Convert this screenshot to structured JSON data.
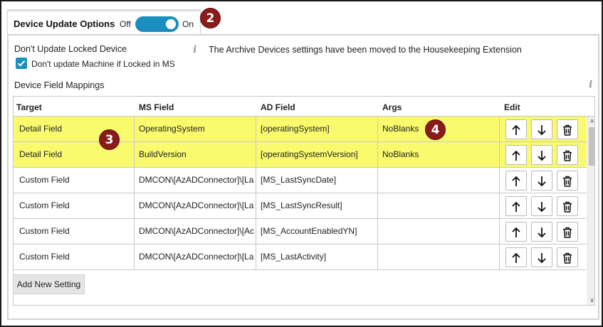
{
  "header": {
    "title": "Device Update Options",
    "toggle_off_label": "Off",
    "toggle_on_label": "On",
    "toggle_state": "on"
  },
  "annotations": {
    "badge_2": "2",
    "badge_3": "3",
    "badge_4": "4"
  },
  "locked": {
    "label": "Don't Update Locked Device",
    "checkbox_label": "Don't update Machine if Locked in MS",
    "checked": true
  },
  "archive_message": "The Archive Devices settings have been moved to the Housekeeping Extension",
  "mappings": {
    "label": "Device Field Mappings",
    "columns": [
      "Target",
      "MS Field",
      "AD Field",
      "Args",
      "Edit"
    ],
    "rows": [
      {
        "target": "Detail Field",
        "ms_field": "OperatingSystem",
        "ad_field": "[operatingSystem]",
        "args": "NoBlanks",
        "highlighted": true
      },
      {
        "target": "Detail Field",
        "ms_field": "BuildVersion",
        "ad_field": "[operatingSystemVersion]",
        "args": "NoBlanks",
        "highlighted": true
      },
      {
        "target": "Custom Field",
        "ms_field": "DMCON\\[AzADConnector]\\[La",
        "ad_field": "[MS_LastSyncDate]",
        "args": "",
        "highlighted": false
      },
      {
        "target": "Custom Field",
        "ms_field": "DMCON\\[AzADConnector]\\[La",
        "ad_field": "[MS_LastSyncResult]",
        "args": "",
        "highlighted": false
      },
      {
        "target": "Custom Field",
        "ms_field": "DMCON\\[AzADConnector]\\[Ac",
        "ad_field": "[MS_AccountEnabledYN]",
        "args": "",
        "highlighted": false
      },
      {
        "target": "Custom Field",
        "ms_field": "DMCON\\[AzADConnector]\\[La",
        "ad_field": "[MS_LastActivity]",
        "args": "",
        "highlighted": false
      }
    ]
  },
  "add_button_label": "Add New Setting",
  "colors": {
    "accent": "#1a8fbf",
    "highlight": "#fafa6e",
    "badge": "#8b1a1a"
  },
  "icons": [
    "info-icon",
    "arrow-up-icon",
    "arrow-down-icon",
    "trash-icon",
    "check-icon"
  ]
}
